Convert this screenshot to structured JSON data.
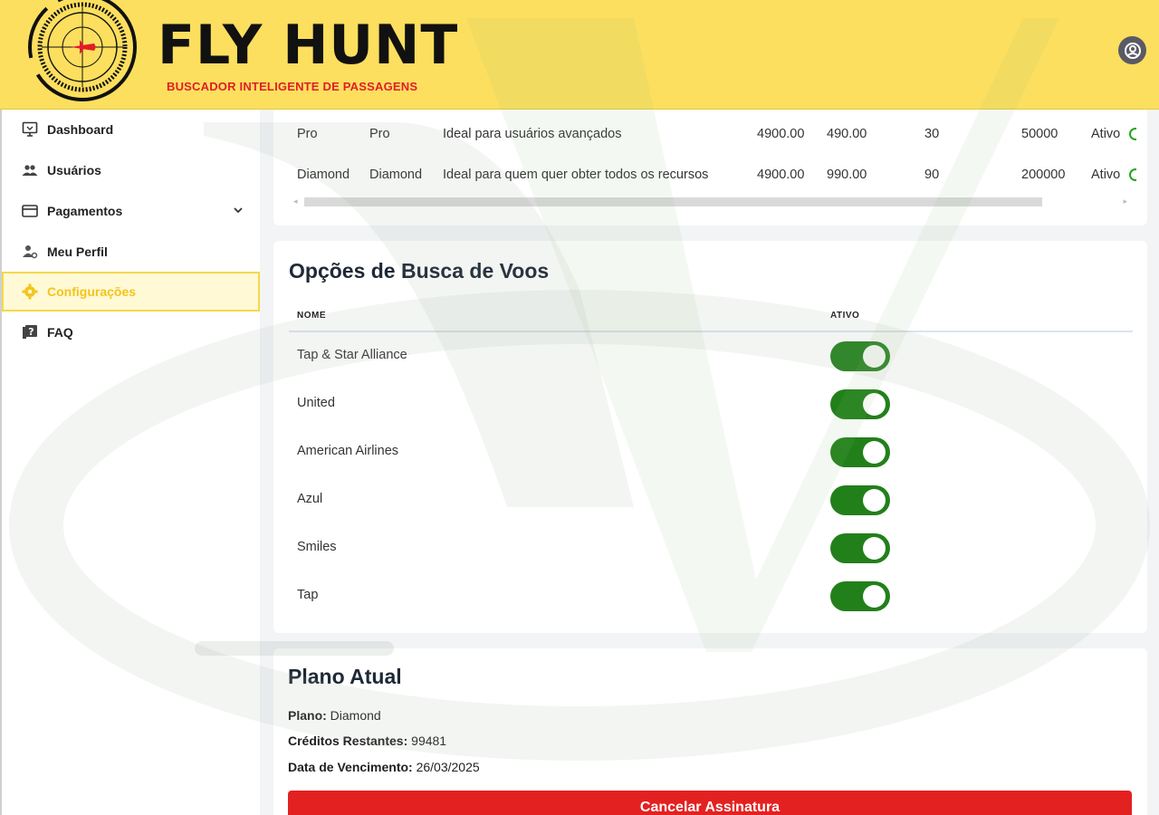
{
  "brand": {
    "title": "FLY HUNT",
    "subtitle": "BUSCADOR INTELIGENTE DE PASSAGENS",
    "header_color": "#fcdf5e",
    "accent_red": "#e11d2a"
  },
  "header": {
    "profile_icon": "user-circle-icon"
  },
  "sidebar": {
    "items": [
      {
        "label": "Dashboard",
        "icon": "monitor-icon",
        "active": false
      },
      {
        "label": "Usuários",
        "icon": "users-icon",
        "active": false
      },
      {
        "label": "Pagamentos",
        "icon": "credit-card-icon",
        "active": false,
        "has_submenu": true
      },
      {
        "label": "Meu Perfil",
        "icon": "user-gear-icon",
        "active": false
      },
      {
        "label": "Configurações",
        "icon": "gear-icon",
        "active": true
      },
      {
        "label": "FAQ",
        "icon": "question-book-icon",
        "active": false
      }
    ]
  },
  "plans_table": {
    "rows": [
      {
        "name": "Pro",
        "slug": "Pro",
        "description": "Ideal para usuários avançados",
        "price_a": "4900.00",
        "price_b": "490.00",
        "days": "30",
        "credits": "50000",
        "status": "Ativo"
      },
      {
        "name": "Diamond",
        "slug": "Diamond",
        "description": "Ideal para quem quer obter todos os recursos",
        "price_a": "4900.00",
        "price_b": "990.00",
        "days": "90",
        "credits": "200000",
        "status": "Ativo"
      }
    ]
  },
  "search_options": {
    "title": "Opções de Busca de Voos",
    "col_name": "NOME",
    "col_active": "ATIVO",
    "rows": [
      {
        "name": "Tap & Star Alliance",
        "active": true
      },
      {
        "name": "United",
        "active": true
      },
      {
        "name": "American Airlines",
        "active": true
      },
      {
        "name": "Azul",
        "active": true
      },
      {
        "name": "Smiles",
        "active": true
      },
      {
        "name": "Tap",
        "active": true
      }
    ],
    "toggle_on_color": "#22801a"
  },
  "current_plan": {
    "title": "Plano Atual",
    "plan_label": "Plano:",
    "plan_value": "Diamond",
    "credits_label": "Créditos Restantes:",
    "credits_value": "99481",
    "expiry_label": "Data de Vencimento:",
    "expiry_value": "26/03/2025",
    "cancel_label": "Cancelar Assinatura",
    "cancel_color": "#e32121"
  }
}
